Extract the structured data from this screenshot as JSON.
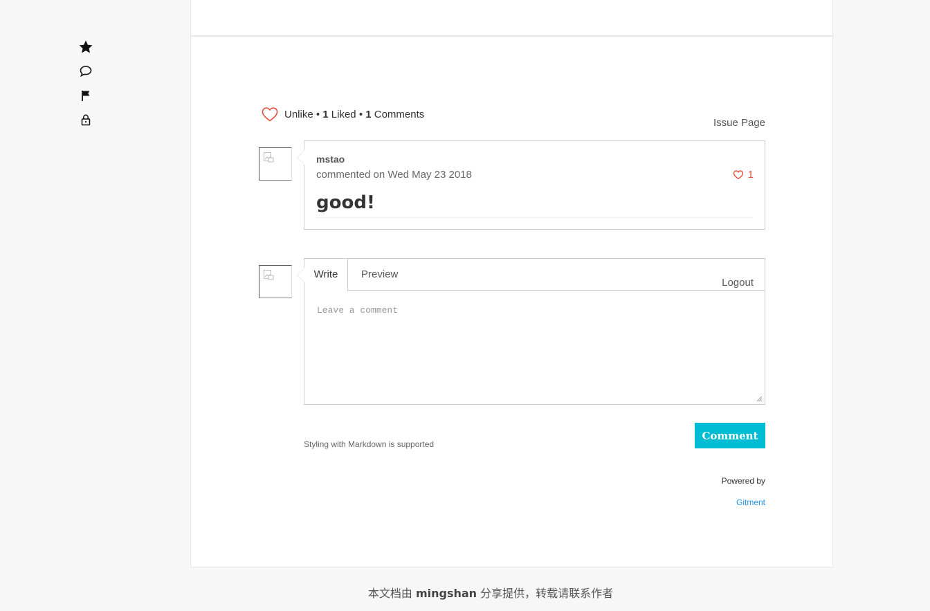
{
  "sidebar": {
    "icons": [
      "star-icon",
      "comment-icon",
      "flag-icon",
      "lock-icon"
    ]
  },
  "meta": {
    "unlike_label": "Unlike",
    "bullet": " • ",
    "liked_count": "1",
    "liked_label": " Liked",
    "comments_count": "1",
    "comments_label": " Comments",
    "issue_page_label": "Issue Page"
  },
  "comment": {
    "author": "mstao",
    "date": "commented on Wed May 23 2018",
    "likes": "1",
    "body": "good!"
  },
  "editor": {
    "tab_write": "Write",
    "tab_preview": "Preview",
    "logout_label": "Logout",
    "placeholder": "Leave a comment",
    "markdown_tip": "Styling with Markdown is supported",
    "submit_label": "Comment",
    "powered_by": "Powered by",
    "gitment_link": "Gitment"
  },
  "site_footer": {
    "prefix": "本文档由 ",
    "author": "mingshan",
    "suffix": " 分享提供，转载请联系作者"
  },
  "colors": {
    "accent": "#00bcd4",
    "like_red": "#e74c3c",
    "link_blue": "#2196f3"
  }
}
